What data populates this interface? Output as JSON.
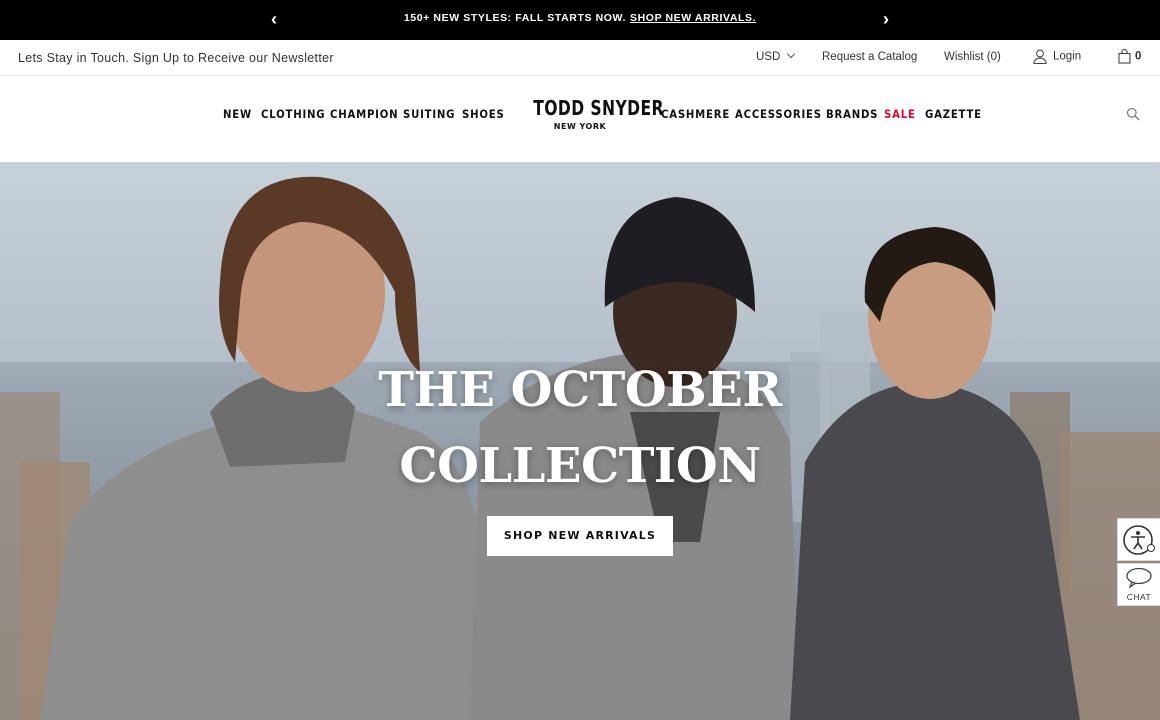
{
  "announcement": {
    "prev": "‹",
    "message": "150+ NEW STYLES: FALL STARTS NOW.",
    "link": "SHOP NEW ARRIVALS.",
    "next": "›"
  },
  "utility": {
    "newsletter": "Lets Stay in Touch. Sign Up to Receive our Newsletter",
    "currency": "USD",
    "catalog": "Request a Catalog",
    "wishlist": "Wishlist (0)",
    "login": "Login",
    "cart_count": "0"
  },
  "nav": {
    "left": [
      "NEW",
      "CLOTHING",
      "CHAMPION",
      "SUITING",
      "SHOES"
    ],
    "right": [
      "CASHMERE",
      "ACCESSORIES",
      "BRANDS",
      "SALE",
      "GAZETTE"
    ],
    "sale_color": "#c8102e"
  },
  "logo": {
    "brand": "TODD SNYDER",
    "city": "NEW YORK"
  },
  "hero": {
    "headline_line1": "THE OCTOBER",
    "headline_line2": "COLLECTION",
    "cta": "SHOP NEW ARRIVALS"
  },
  "widgets": {
    "chat_label": "CHAT"
  },
  "icons": {
    "prev": "chevron-left-icon",
    "next": "chevron-right-icon",
    "currency": "chevron-down-icon",
    "login": "user-icon",
    "cart": "shopping-bag-icon",
    "search": "search-icon",
    "accessibility": "accessibility-icon",
    "chat": "chat-bubble-icon"
  }
}
